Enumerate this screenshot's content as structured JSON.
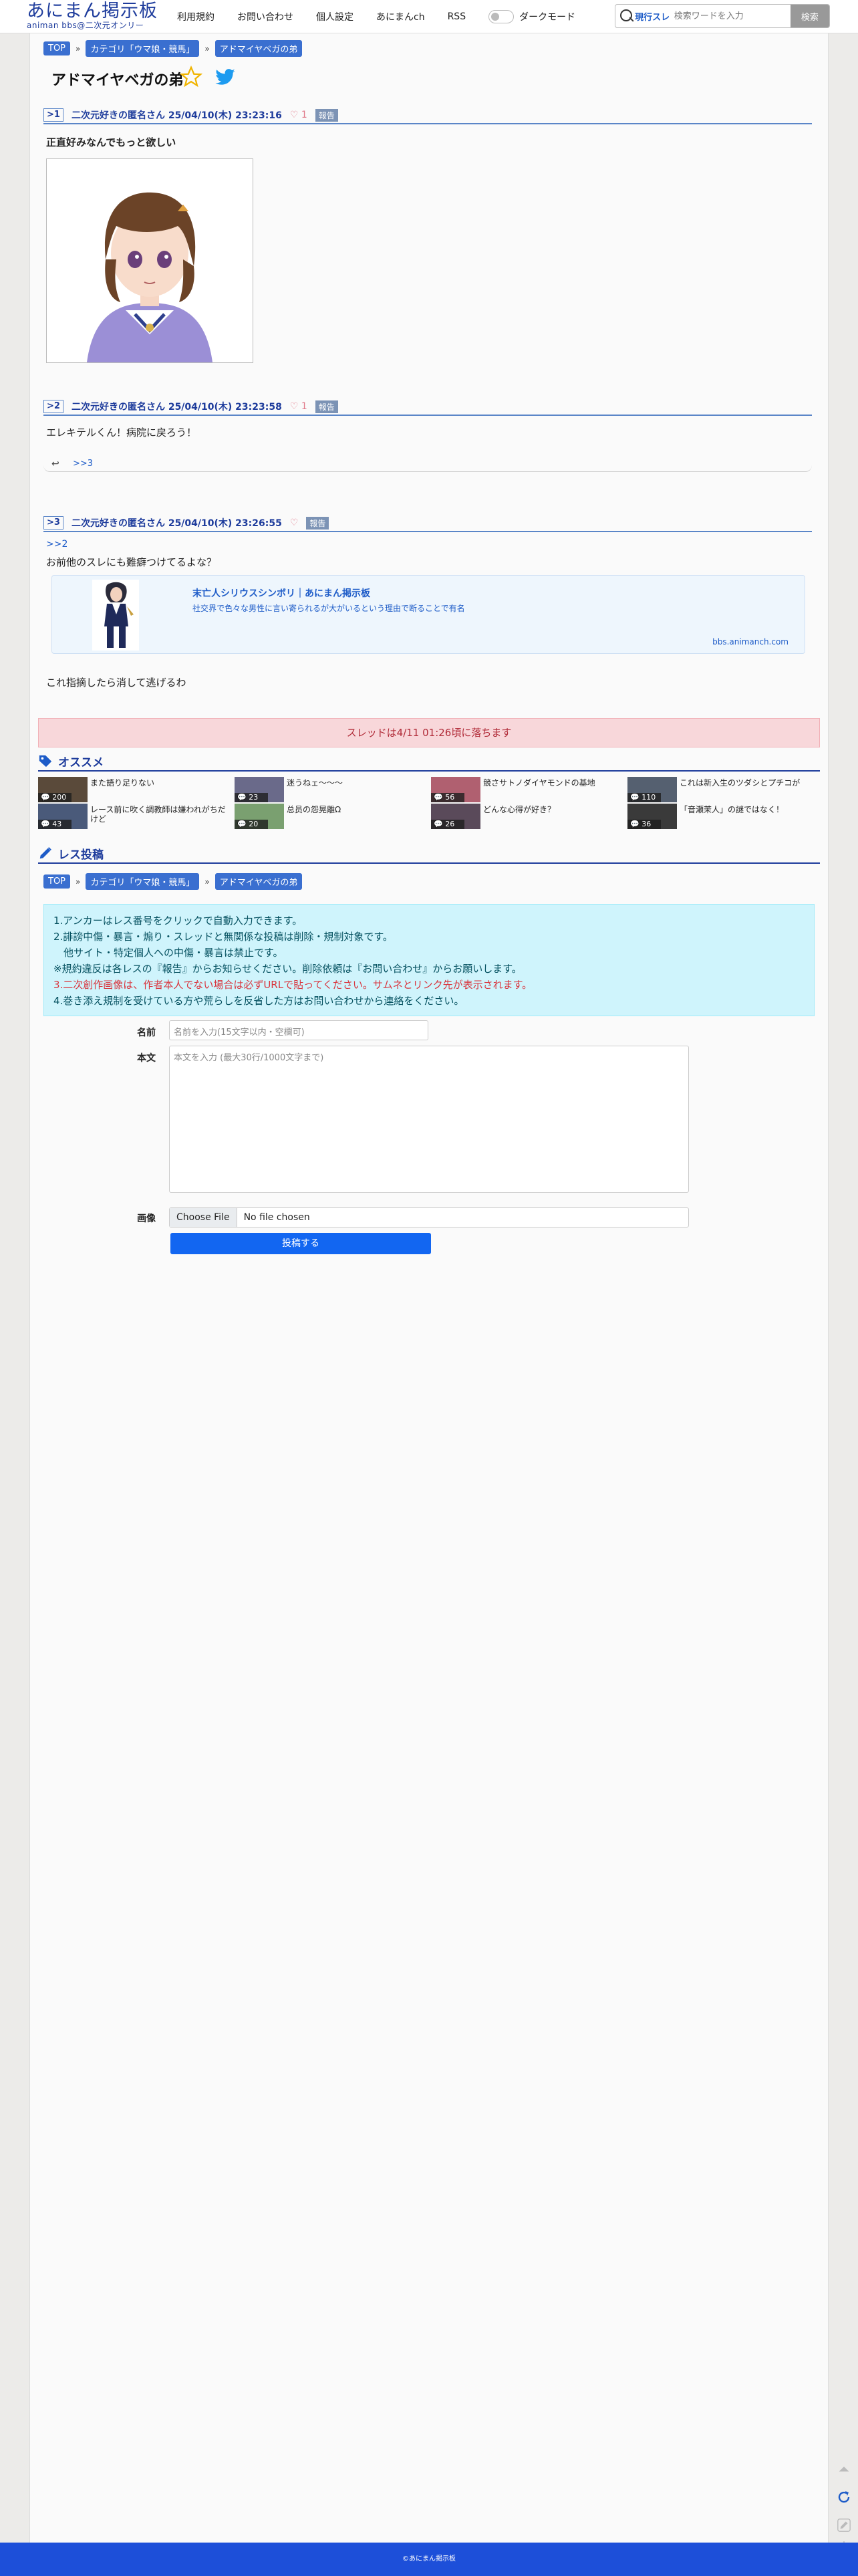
{
  "header": {
    "logo_main": "あにまん掲示板",
    "logo_sub": "animan bbs@二次元オンリー",
    "nav": [
      "利用規約",
      "お問い合わせ",
      "個人設定",
      "あにまんch",
      "RSS"
    ],
    "dark_mode_label": "ダークモード",
    "search_scope": "現行スレ",
    "search_placeholder": "検索ワードを入力",
    "search_button": "検索"
  },
  "breadcrumb": [
    "TOP",
    "カテゴリ「ウマ娘・競馬」",
    "アドマイヤベガの弟"
  ],
  "thread": {
    "title": "アドマイヤベガの弟",
    "posts": [
      {
        "no": ">1",
        "meta": "二次元好きの匿名さん 25/04/10(木) 23:23:16",
        "likes": "1",
        "report": "報告",
        "body": "正直好みなんでもっと欲しい"
      },
      {
        "no": ">2",
        "meta": "二次元好きの匿名さん 25/04/10(木) 23:23:58",
        "likes": "1",
        "report": "報告",
        "body": "エレキテルくん！病院に戻ろう！",
        "reply": ">>3"
      },
      {
        "no": ">3",
        "meta": "二次元好きの匿名さん 25/04/10(木) 23:26:55",
        "likes": "",
        "report": "報告",
        "anchor": ">>2",
        "body": "お前他のスレにも難癖つけてるよな？",
        "body2": "これ指摘したら消して逃げるわ"
      }
    ],
    "link_card": {
      "title": "末亡人シリウスシンボリ｜あにまん掲示板",
      "desc": "社交界で色々な男性に言い寄られるが大がいるという理由で断ることで有名",
      "domain": "bbs.animanch.com"
    },
    "expire_notice": "スレッドは4/11 01:26頃に落ちます"
  },
  "recommend": {
    "heading": "オススメ",
    "items": [
      {
        "title": "また語り足りない",
        "count": "200",
        "color": "#5a4a3a"
      },
      {
        "title": "迷うねェ〜〜〜",
        "count": "23",
        "color": "#6a6a8a"
      },
      {
        "title": "競さサトノダイヤモンドの基地",
        "count": "56",
        "color": "#b06070"
      },
      {
        "title": "これは新入生のツダシとプチコが",
        "count": "110",
        "color": "#556070"
      },
      {
        "title": "レース前に吹く調教師は嫌われがちだけど",
        "count": "43",
        "color": "#4a5a7a"
      },
      {
        "title": "总员の怨晃離Ω",
        "count": "20",
        "color": "#7aa070"
      },
      {
        "title": "どんな心得が好き？",
        "count": "26",
        "color": "#5a4a5a"
      },
      {
        "title": "「音瀬茉人」の謎ではなく！",
        "count": "36",
        "color": "#3a3a3a"
      }
    ]
  },
  "post_form": {
    "heading": "レス投稿",
    "notice_lines": [
      "1.アンカーはレス番号をクリックで自動入力できます。",
      "2.誹謗中傷・暴言・煽り・スレッドと無関係な投稿は削除・規制対象です。",
      "　他サイト・特定個人への中傷・暴言は禁止です。",
      "※規約違反は各レスの『報告』からお知らせください。削除依頼は『お問い合わせ』からお願いします。",
      "3.二次創作画像は、作者本人でない場合は必ずURLで貼ってください。サムネとリンク先が表示されます。",
      "4.巻き添え規制を受けている方や荒らしを反省した方はお問い合わせから連絡をください。"
    ],
    "name_label": "名前",
    "name_placeholder": "名前を入力(15文字以内・空欄可)",
    "body_label": "本文",
    "body_placeholder": "本文を入力 (最大30行/1000文字まで)",
    "image_label": "画像",
    "file_button": "Choose File",
    "file_status": "No file chosen",
    "submit": "投稿する"
  },
  "footer": "©あにまん掲示板",
  "colors": {
    "accent": "#1e3c9c",
    "link": "#1e5cc8",
    "submit": "#1266f1",
    "footer": "#1d4fd9"
  }
}
